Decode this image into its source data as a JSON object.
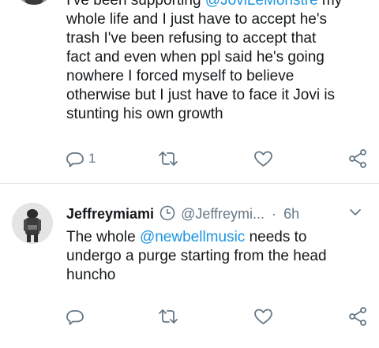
{
  "tweet1": {
    "partial_line_start": "I've been supporting ",
    "partial_line_mention": "@JoviLeMonstre",
    "partial_line_end": " my",
    "lines": [
      "whole life and I just have to accept he's",
      "trash I've been refusing to accept that",
      "fact and even when ppl said he's going",
      "nowhere I forced myself to believe",
      "otherwise but I just have to face it Jovi is",
      "stunting his own growth"
    ],
    "reply_count": "1"
  },
  "tweet2": {
    "display_name": "Jeffreymiami",
    "handle": "@Jeffreymi...",
    "separator": "·",
    "time": "6h",
    "text_line1_start": "The whole ",
    "text_line1_mention": "@newbellmusic",
    "text_line1_end": " needs to",
    "lines": [
      "undergo a purge starting from the head",
      "huncho"
    ]
  },
  "colors": {
    "accent": "#1b95e0",
    "icon_gray": "#657786",
    "divider": "#e1e8ed"
  },
  "icons": {
    "reply": "reply-icon",
    "retweet": "retweet-icon",
    "like": "heart-icon",
    "share": "share-icon",
    "clock": "clock-icon",
    "caret": "chevron-down-icon"
  }
}
